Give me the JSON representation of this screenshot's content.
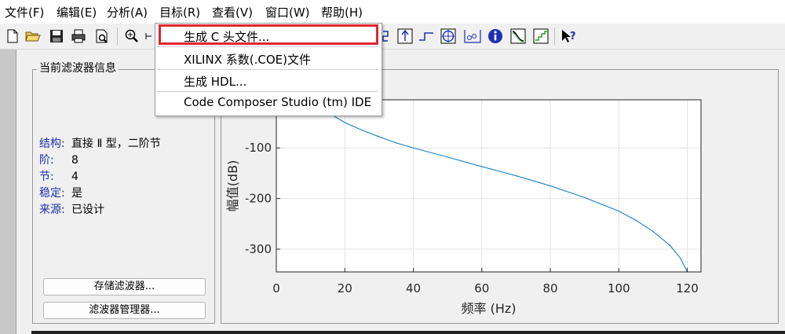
{
  "menubar": {
    "items": [
      "文件(F)",
      "编辑(E)",
      "分析(A)",
      "目标(R)",
      "查看(V)",
      "窗口(W)",
      "帮助(H)"
    ]
  },
  "toolbar": {
    "icons": [
      "new-file-icon",
      "open-folder-icon",
      "save-icon",
      "print-icon",
      "print-preview-icon",
      "zoom-in-icon",
      "magnitude-response-icon",
      "step-response-icon",
      "pole-zero-icon",
      "impulse-response-icon",
      "info-icon",
      "filter-spec-icon",
      "quantize-icon",
      "whats-this-icon"
    ]
  },
  "target_menu": {
    "items": [
      {
        "label": "生成 C 头文件..."
      },
      {
        "label": "XILINX 系数(.COE)文件"
      },
      {
        "label": "生成 HDL..."
      },
      {
        "label": "Code Composer Studio (tm) IDE"
      }
    ],
    "highlight_color": "#e0262f"
  },
  "filter_info": {
    "title": "当前滤波器信息",
    "rows": [
      {
        "key": "结构:",
        "value": "直接 Ⅱ 型，二阶节"
      },
      {
        "key": "阶:",
        "value": "8"
      },
      {
        "key": "节:",
        "value": "4"
      },
      {
        "key": "稳定:",
        "value": "是"
      },
      {
        "key": "来源:",
        "value": "已设计"
      }
    ],
    "store_button": "存储滤波器...",
    "manager_button": "滤波器管理器..."
  },
  "chart_data": {
    "type": "line",
    "xlabel": "频率 (Hz)",
    "ylabel": "幅值(dB)",
    "xlim": [
      0,
      124
    ],
    "ylim": [
      -345,
      -5
    ],
    "xticks": [
      0,
      20,
      40,
      60,
      80,
      100,
      120
    ],
    "yticks": [
      -100,
      -200,
      -300
    ],
    "grid": true,
    "series_color": "#0072bd",
    "x": [
      11,
      15,
      20,
      25,
      30,
      35,
      40,
      50,
      60,
      70,
      80,
      90,
      100,
      105,
      110,
      115,
      118,
      120
    ],
    "y": [
      -5,
      -30,
      -50,
      -65,
      -78,
      -90,
      -100,
      -118,
      -137,
      -155,
      -175,
      -198,
      -225,
      -243,
      -265,
      -293,
      -318,
      -345
    ]
  }
}
